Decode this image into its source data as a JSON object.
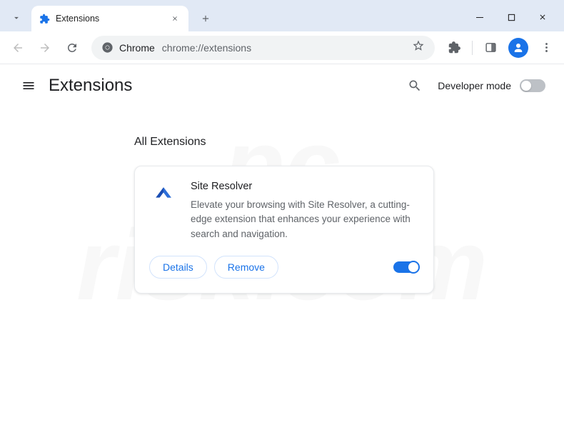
{
  "tab": {
    "title": "Extensions"
  },
  "omnibox": {
    "label": "Chrome",
    "url": "chrome://extensions"
  },
  "page": {
    "title": "Extensions",
    "section_title": "All Extensions",
    "dev_mode_label": "Developer mode",
    "dev_mode_enabled": false
  },
  "extensions": [
    {
      "name": "Site Resolver",
      "description": "Elevate your browsing with Site Resolver, a cutting-edge extension that enhances your experience with search and navigation.",
      "enabled": true,
      "details_label": "Details",
      "remove_label": "Remove",
      "icon_color_primary": "#1a4db3",
      "icon_color_secondary": "#2d6fd9"
    }
  ],
  "watermark": "pc\nrisk.com"
}
